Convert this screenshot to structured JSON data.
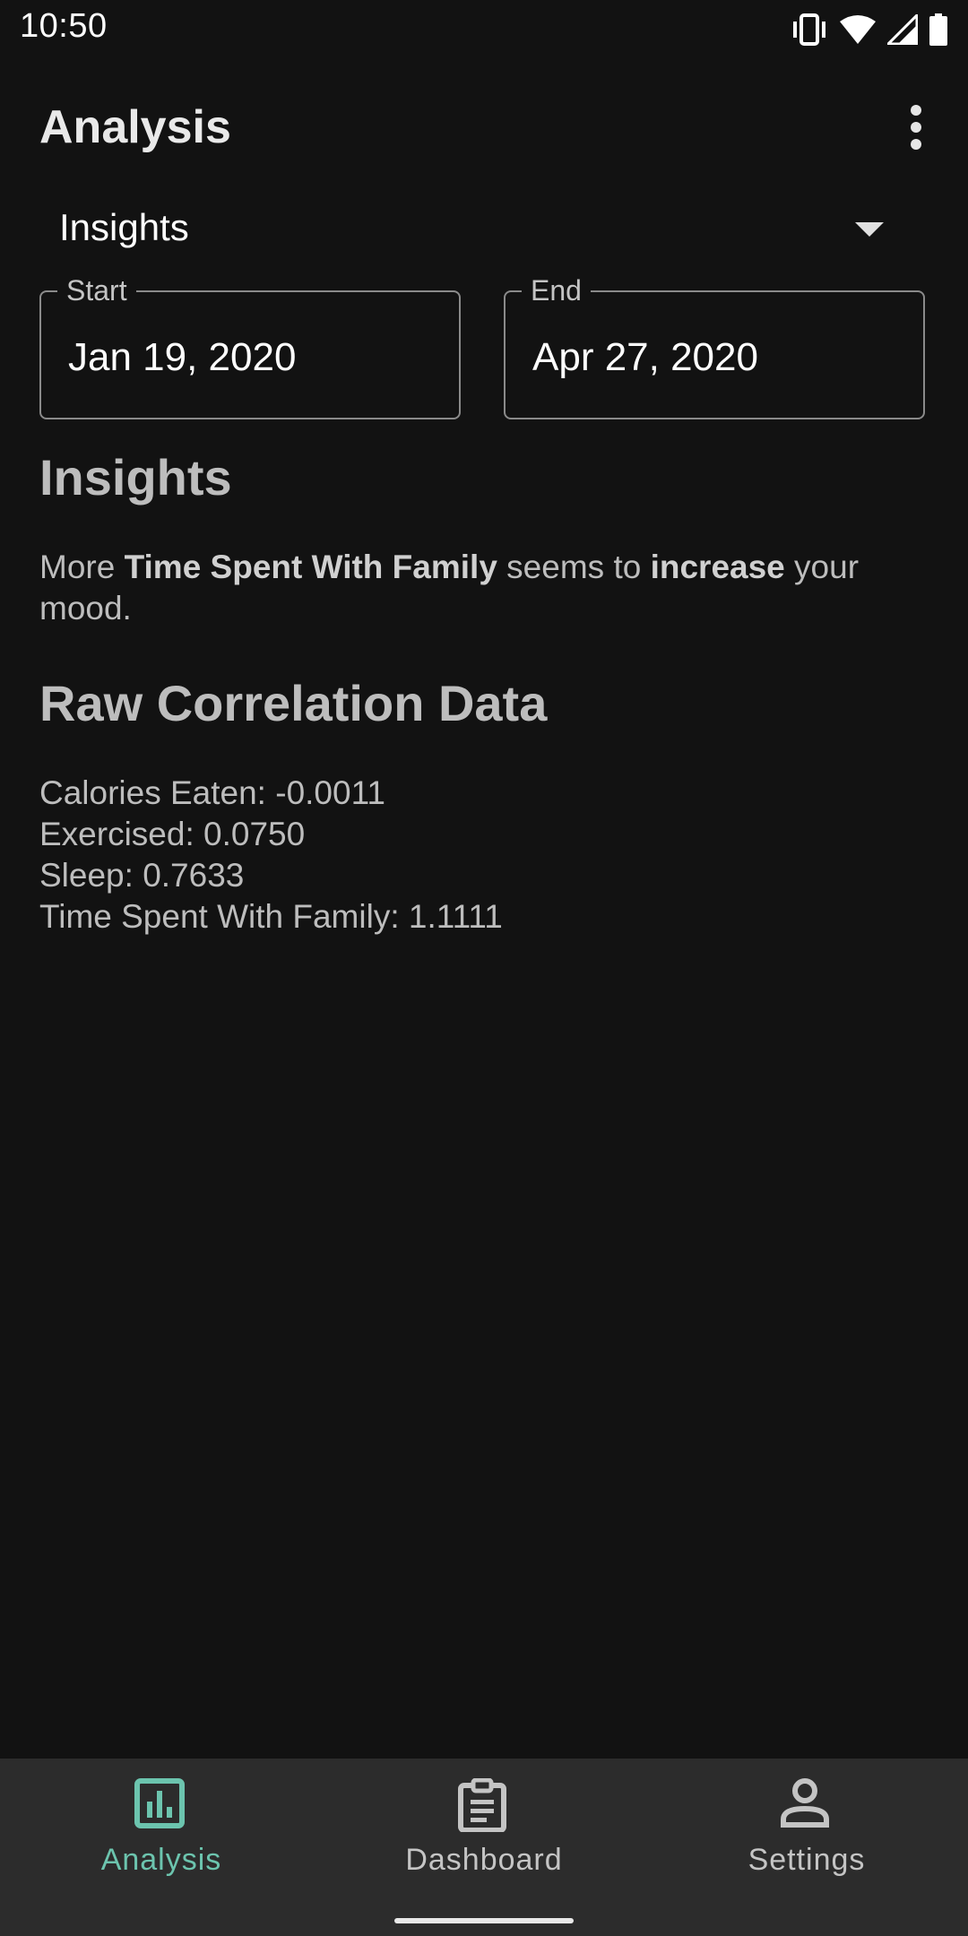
{
  "status_bar": {
    "time": "10:50",
    "icons": [
      "vibrate-icon",
      "wifi-icon",
      "signal-icon",
      "battery-icon"
    ]
  },
  "app_bar": {
    "title": "Analysis",
    "menu_icon": "more-vert-icon"
  },
  "dropdown": {
    "selected": "Insights",
    "icon": "arrow-drop-down-icon"
  },
  "date_range": {
    "start_label": "Start",
    "start_value": "Jan 19, 2020",
    "end_label": "End",
    "end_value": "Apr 27, 2020"
  },
  "insights": {
    "heading": "Insights",
    "text_before": "More ",
    "factor": "Time Spent With Family",
    "text_middle": " seems to ",
    "direction": "increase",
    "text_after": " your mood."
  },
  "raw": {
    "heading": "Raw Correlation Data",
    "items": [
      "Calories Eaten: -0.0011",
      "Exercised: 0.0750",
      "Sleep: 0.7633",
      "Time Spent With Family: 1.1111"
    ]
  },
  "bottom_nav": {
    "items": [
      {
        "label": "Analysis",
        "icon": "bar-chart-icon",
        "active": true
      },
      {
        "label": "Dashboard",
        "icon": "clipboard-icon",
        "active": false
      },
      {
        "label": "Settings",
        "icon": "person-icon",
        "active": false
      }
    ]
  },
  "colors": {
    "background": "#121212",
    "nav_background": "#2c2c2c",
    "accent": "#6cc4ae",
    "text_secondary": "#bdbdbd"
  }
}
